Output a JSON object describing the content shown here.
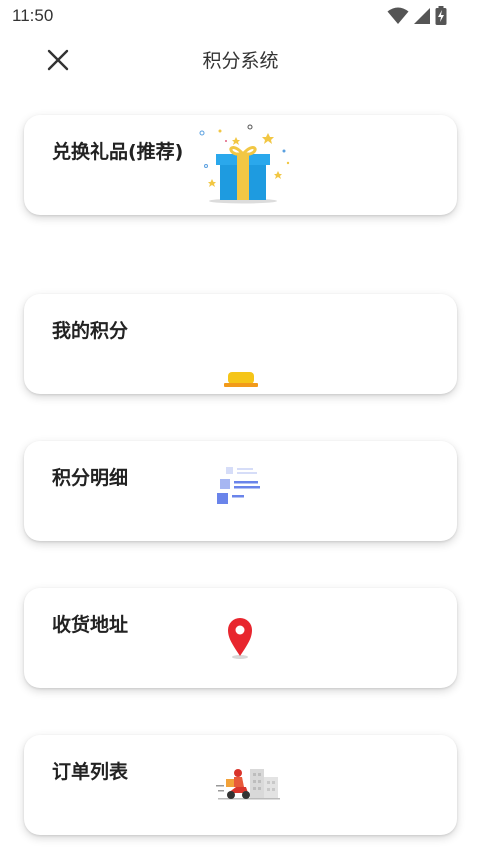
{
  "status_bar": {
    "time": "11:50",
    "icons": [
      "wifi-icon",
      "cellular-signal-icon",
      "battery-charging-icon"
    ]
  },
  "app_bar": {
    "title": "积分系统",
    "close_icon": "close-icon"
  },
  "cards": [
    {
      "name": "exchange-gifts",
      "title": "兑换礼品(推荐)",
      "icon": "gift-box-icon"
    },
    {
      "name": "my-points",
      "title": "我的积分",
      "icon": "gold-coin-icon"
    },
    {
      "name": "points-details",
      "title": "积分明细",
      "icon": "list-details-icon"
    },
    {
      "name": "shipping-address",
      "title": "收货地址",
      "icon": "location-pin-icon"
    },
    {
      "name": "order-list",
      "title": "订单列表",
      "icon": "delivery-scooter-icon"
    }
  ],
  "colors": {
    "gift_blue": "#1e9be0",
    "gift_ribbon": "#f2c744",
    "coin_yellow": "#f5c518",
    "list_blue": "#6a84ea",
    "pin_red": "#e8262e"
  }
}
